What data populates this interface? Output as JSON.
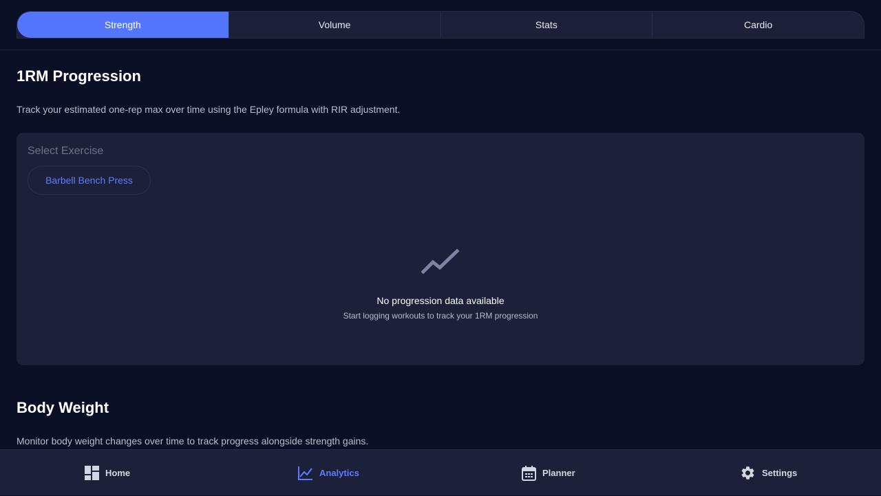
{
  "tabs": [
    {
      "label": "Strength",
      "active": true
    },
    {
      "label": "Volume",
      "active": false
    },
    {
      "label": "Stats",
      "active": false
    },
    {
      "label": "Cardio",
      "active": false
    }
  ],
  "strength_section": {
    "title": "1RM Progression",
    "description": "Track your estimated one-rep max over time using the Epley formula with RIR adjustment.",
    "select_label": "Select Exercise",
    "selected_exercise": "Barbell Bench Press",
    "empty_icon": "trending-line-icon",
    "empty_title": "No progression data available",
    "empty_subtitle": "Start logging workouts to track your 1RM progression"
  },
  "body_weight_section": {
    "title": "Body Weight",
    "description": "Monitor body weight changes over time to track progress alongside strength gains."
  },
  "bottom_nav": [
    {
      "label": "Home",
      "icon": "dashboard-icon",
      "active": false
    },
    {
      "label": "Analytics",
      "icon": "chart-line-icon",
      "active": true
    },
    {
      "label": "Planner",
      "icon": "calendar-icon",
      "active": false
    },
    {
      "label": "Settings",
      "icon": "gear-icon",
      "active": false
    }
  ],
  "colors": {
    "background": "#0b0f26",
    "surface": "#1c2139",
    "accent": "#5476ff",
    "muted_text": "#b9bdd0"
  }
}
